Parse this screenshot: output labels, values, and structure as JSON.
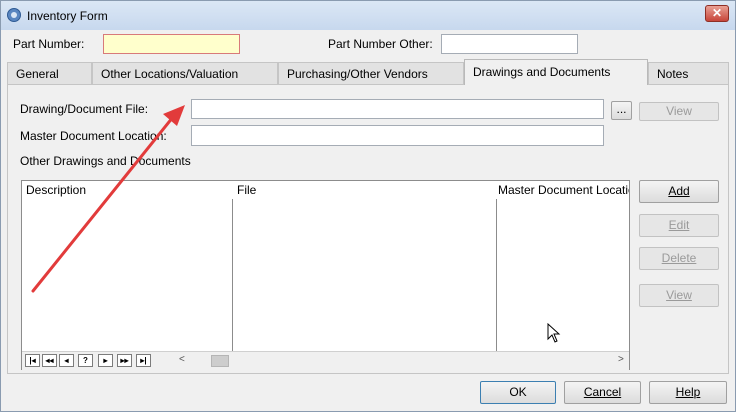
{
  "window": {
    "title": "Inventory Form",
    "close_label": "✕"
  },
  "header": {
    "part_number_label": "Part Number:",
    "part_number_value": "",
    "part_number_other_label": "Part Number Other:",
    "part_number_other_value": ""
  },
  "tabs": [
    {
      "label": "General"
    },
    {
      "label": "Other Locations/Valuation"
    },
    {
      "label": "Purchasing/Other Vendors"
    },
    {
      "label": "Drawings and Documents"
    },
    {
      "label": "Notes"
    }
  ],
  "drawings": {
    "file_label": "Drawing/Document File:",
    "file_value": "",
    "browse_label": "...",
    "view_label": "View",
    "master_label": "Master Document Location:",
    "master_value": "",
    "other_label": "Other Drawings and Documents"
  },
  "grid": {
    "columns": [
      "Description",
      "File",
      "Master Document Location"
    ],
    "nav": [
      "|◂",
      "◂◂",
      "◂",
      "?",
      "▸",
      "▸▸",
      "▸|"
    ],
    "scroll_left": "<",
    "scroll_right": ">"
  },
  "side_buttons": {
    "add": "Add",
    "edit": "Edit",
    "delete": "Delete",
    "view": "View"
  },
  "footer": {
    "ok": "OK",
    "cancel": "Cancel",
    "help": "Help"
  }
}
